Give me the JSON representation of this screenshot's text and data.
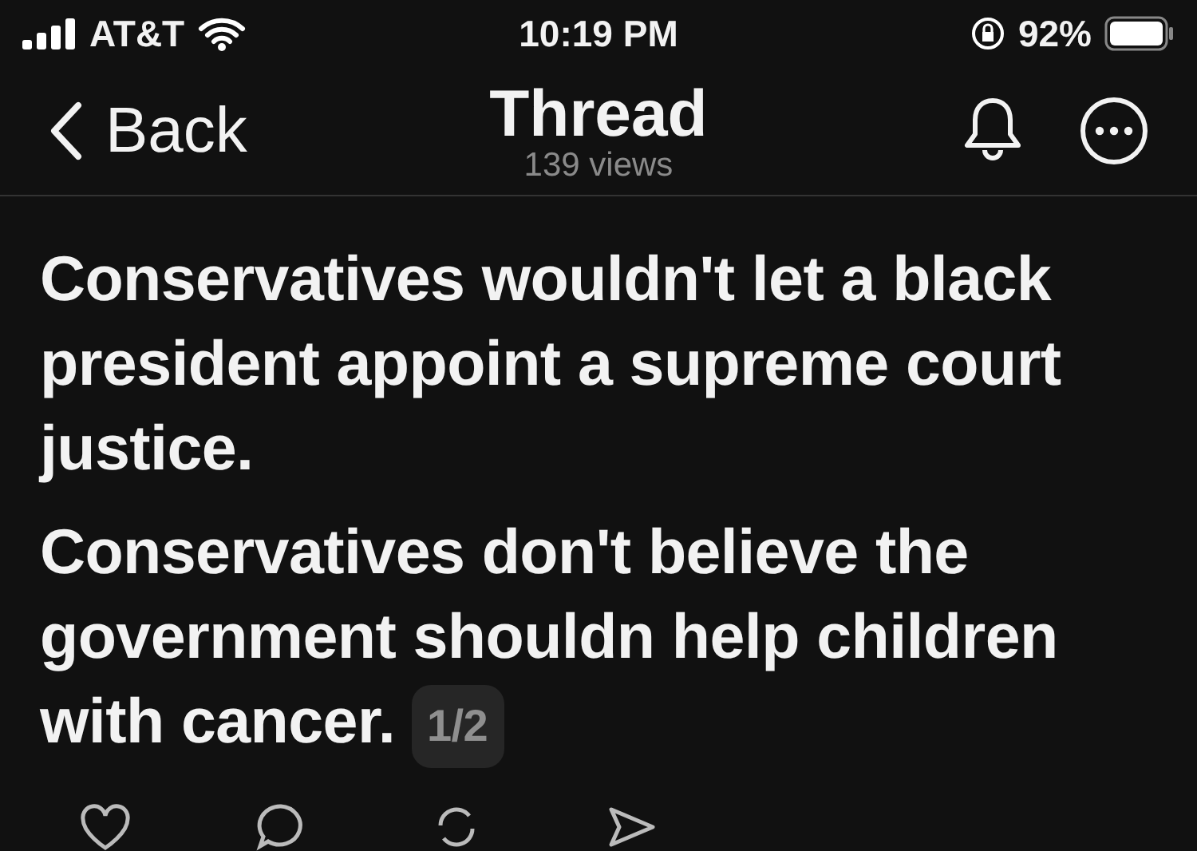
{
  "status_bar": {
    "carrier": "AT&T",
    "time": "10:19 PM",
    "battery": "92%"
  },
  "nav": {
    "back": "Back",
    "title": "Thread",
    "subtitle": "139 views"
  },
  "post": {
    "paragraphs": [
      "Conservatives wouldn't let a black president appoint a supreme court justice.",
      "Conservatives don't believe the government shouldn help children with cancer."
    ],
    "page_badge": "1/2"
  }
}
